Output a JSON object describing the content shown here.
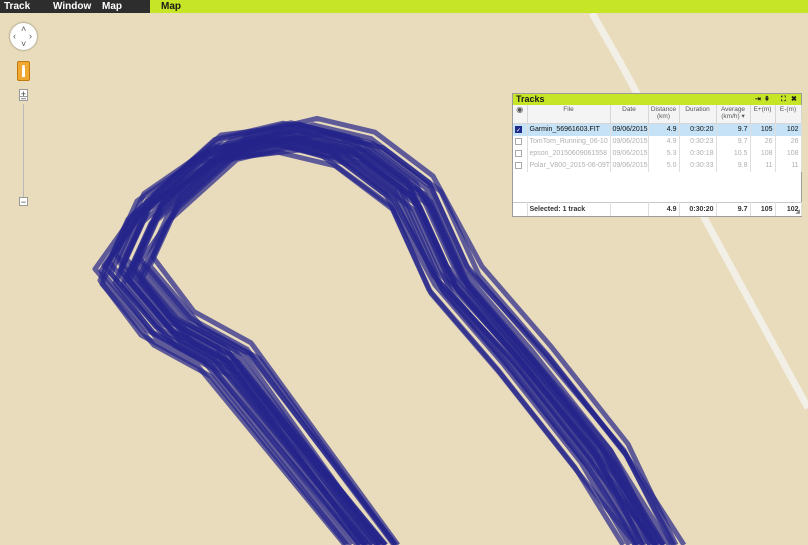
{
  "menu": {
    "items": [
      "Track",
      "Window",
      "Map"
    ],
    "active_tab": "Map"
  },
  "map": {
    "track_color": "#23238a",
    "background_color": "#e9dcbc",
    "road_color": "#f2efe6"
  },
  "tracks_panel": {
    "title": "Tracks",
    "title_buttons": [
      "⇥",
      "⇞",
      "⛶",
      "✖"
    ],
    "columns": {
      "file": "File",
      "date": "Date",
      "distance": "Distance\n(km)",
      "duration": "Duration",
      "average": "Average\n(km/h) ▾",
      "eplus": "E+(m)",
      "eminus": "E-(m)"
    },
    "rows": [
      {
        "checked": true,
        "file": "Garmin_56961603.FIT",
        "date": "09/06/2015",
        "distance": "4.9",
        "duration": "0:30:20",
        "average": "9.7",
        "eplus": "105",
        "eminus": "102",
        "state": "selected"
      },
      {
        "checked": false,
        "file": "TomTom_Running_06-10",
        "date": "09/06/2015",
        "distance": "4.9",
        "duration": "0:30:23",
        "average": "9.7",
        "eplus": "26",
        "eminus": "26",
        "state": "dim"
      },
      {
        "checked": false,
        "file": "epson_20150609061558",
        "date": "09/06/2015",
        "distance": "5.3",
        "duration": "0:30:18",
        "average": "10.5",
        "eplus": "108",
        "eminus": "108",
        "state": "dim"
      },
      {
        "checked": false,
        "file": "Polar_V800_2015-06-09T",
        "date": "09/06/2015",
        "distance": "5.0",
        "duration": "0:30:33",
        "average": "9.8",
        "eplus": "11",
        "eminus": "11",
        "state": "dim"
      }
    ],
    "footer": {
      "label": "Selected: 1 track",
      "distance": "4.9",
      "duration": "0:30:20",
      "average": "9.7",
      "eplus": "105",
      "eminus": "102"
    }
  }
}
